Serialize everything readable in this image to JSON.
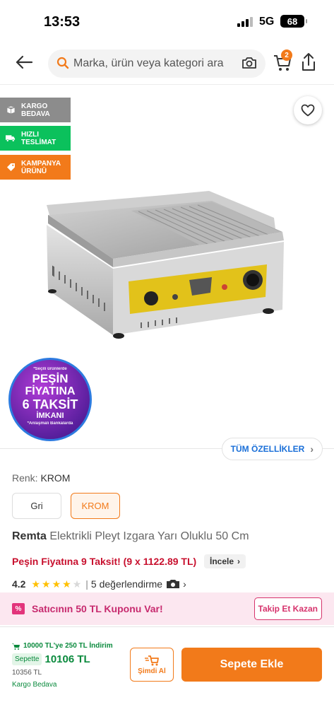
{
  "status_bar": {
    "time": "13:53",
    "network": "5G",
    "battery": "68"
  },
  "header": {
    "search_placeholder": "Marka, ürün veya kategori ara",
    "cart_count": "2"
  },
  "tags": {
    "kargo": "KARGO BEDAVA",
    "hizli": "HIZLI TESLİMAT",
    "kampanya": "KAMPANYA ÜRÜNÜ"
  },
  "promo_badge": {
    "line_small": "*Seçili ürünlerde",
    "line1": "PEŞİN",
    "line2": "FİYATINA",
    "line3": "6 TAKSİT",
    "line4": "İMKANI",
    "line_small2": "*Anlaşmalı Bankalarda"
  },
  "all_features_label": "TÜM ÖZELLİKLER",
  "product": {
    "color_label": "Renk:",
    "color_value": "KROM",
    "options": [
      "Gri",
      "KROM"
    ],
    "brand": "Remta",
    "name": "Elektrikli Pleyt Izgara Yarı Oluklu 50 Cm",
    "installment_text": "Peşin Fiyatına 9 Taksit! (9 x 1122.89 TL)",
    "incele_label": "İncele",
    "rating": "4.2",
    "rating_stars": 4.2,
    "reviews_text": "5 değerlendirme"
  },
  "coupon": {
    "text": "Satıcının 50 TL Kuponu Var!",
    "button": "Takip Et Kazan"
  },
  "bottom": {
    "discount_text": "10000 TL'ye 250 TL İndirim",
    "sepette_label": "Sepette",
    "sepette_price": "10106 TL",
    "old_price": "10356 TL",
    "shipping": "Kargo Bedava",
    "buy_now": "Şimdi Al",
    "add_to_cart": "Sepete Ekle"
  },
  "colors": {
    "accent": "#f27a1a",
    "green": "#0bc15c",
    "coupon_pink": "#c72a6e"
  }
}
